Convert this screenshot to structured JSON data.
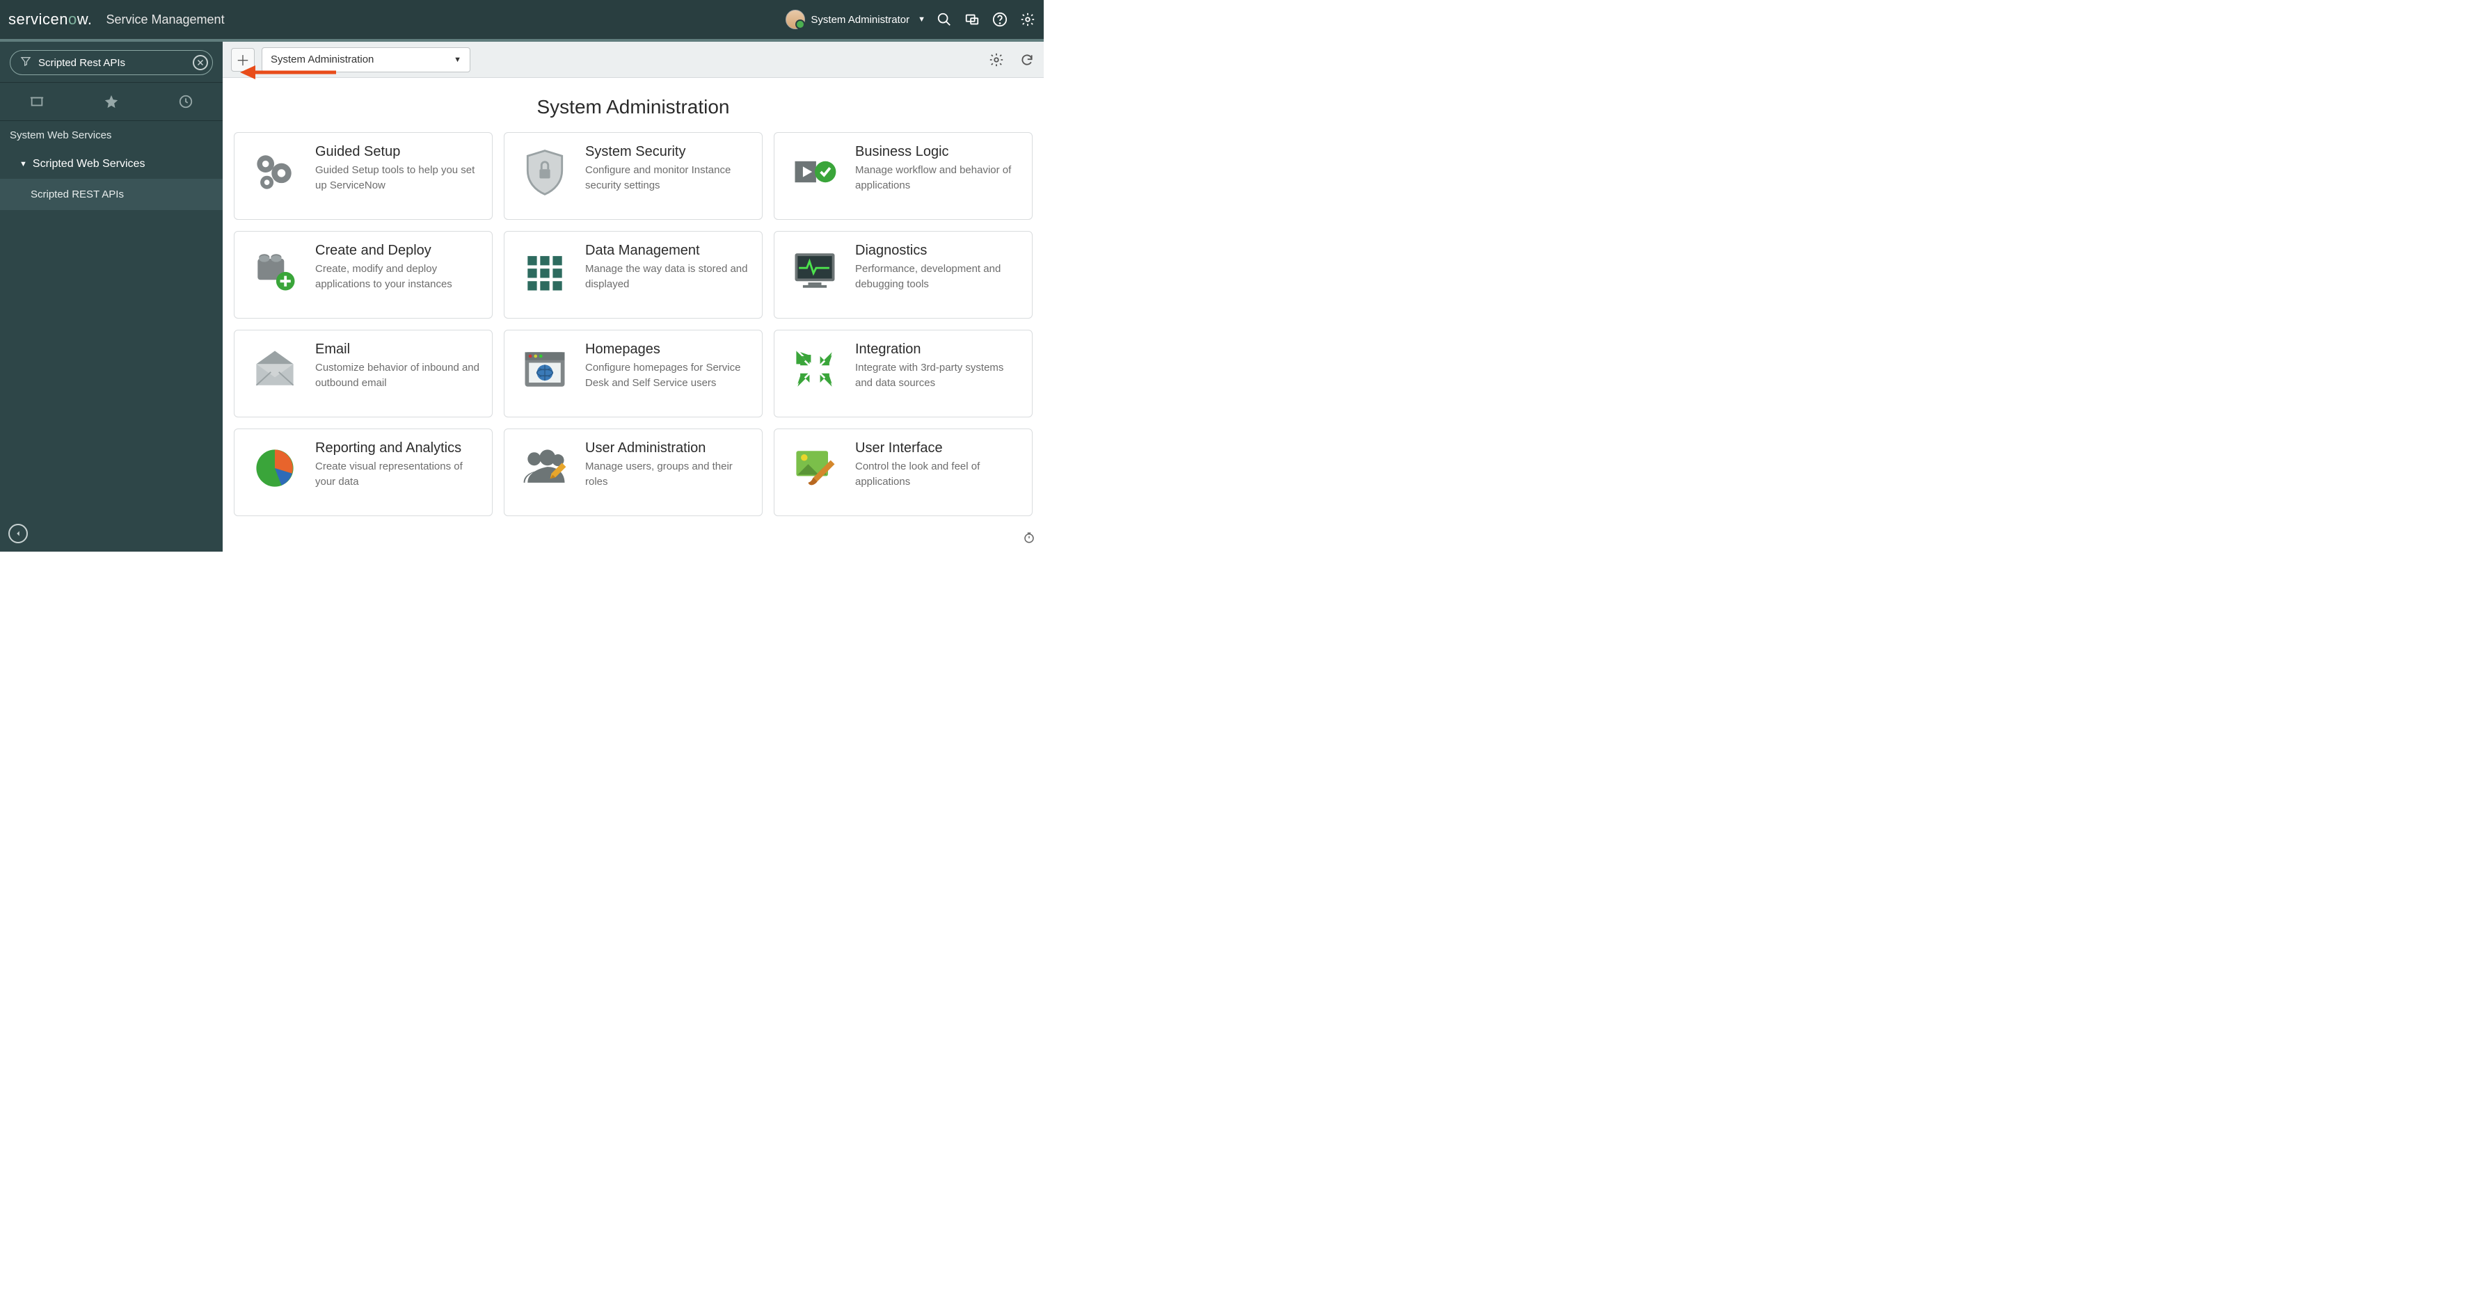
{
  "brand": {
    "name": "servicenow",
    "product": "Service Management"
  },
  "user": {
    "name": "System Administrator"
  },
  "filter": {
    "value": "Scripted Rest APIs"
  },
  "nav": {
    "section": "System Web Services",
    "group": "Scripted Web Services",
    "item": "Scripted REST APIs"
  },
  "toolbar": {
    "context": "System Administration"
  },
  "page_title": "System Administration",
  "cards": [
    {
      "title": "Guided Setup",
      "desc": "Guided Setup tools to help you set up ServiceNow"
    },
    {
      "title": "System Security",
      "desc": "Configure and monitor Instance security settings"
    },
    {
      "title": "Business Logic",
      "desc": "Manage workflow and behavior of applications"
    },
    {
      "title": "Create and Deploy",
      "desc": "Create, modify and deploy applications to your instances"
    },
    {
      "title": "Data Management",
      "desc": "Manage the way data is stored and displayed"
    },
    {
      "title": "Diagnostics",
      "desc": "Performance, development and debugging tools"
    },
    {
      "title": "Email",
      "desc": "Customize behavior of inbound and outbound email"
    },
    {
      "title": "Homepages",
      "desc": "Configure homepages for Service Desk and Self Service users"
    },
    {
      "title": "Integration",
      "desc": "Integrate with 3rd-party systems and data sources"
    },
    {
      "title": "Reporting and Analytics",
      "desc": "Create visual representations of your data"
    },
    {
      "title": "User Administration",
      "desc": "Manage users, groups and their roles"
    },
    {
      "title": "User Interface",
      "desc": "Control the look and feel of applications"
    }
  ]
}
